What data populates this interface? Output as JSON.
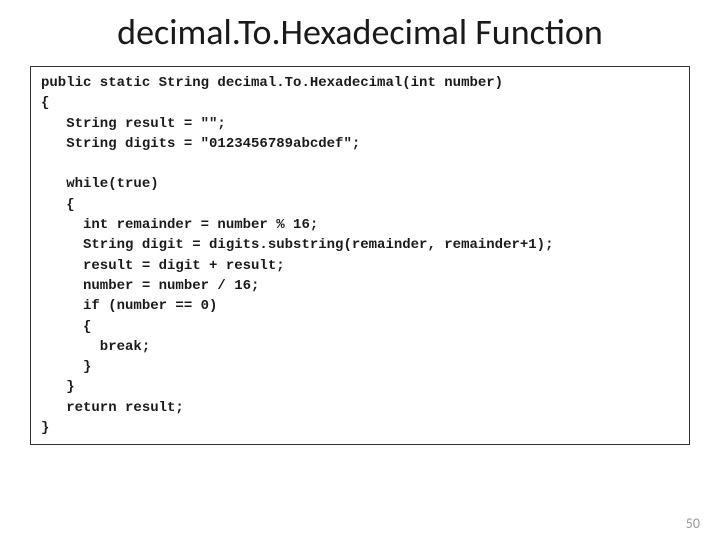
{
  "title": "decimal.To.Hexadecimal Function",
  "code": "public static String decimal.To.Hexadecimal(int number)\n{\n   String result = \"\";\n   String digits = \"0123456789abcdef\";\n\n   while(true)\n   {\n     int remainder = number % 16;\n     String digit = digits.substring(remainder, remainder+1);\n     result = digit + result;\n     number = number / 16;\n     if (number == 0)\n     {\n       break;\n     }\n   }\n   return result;\n}",
  "pageNumber": "50"
}
